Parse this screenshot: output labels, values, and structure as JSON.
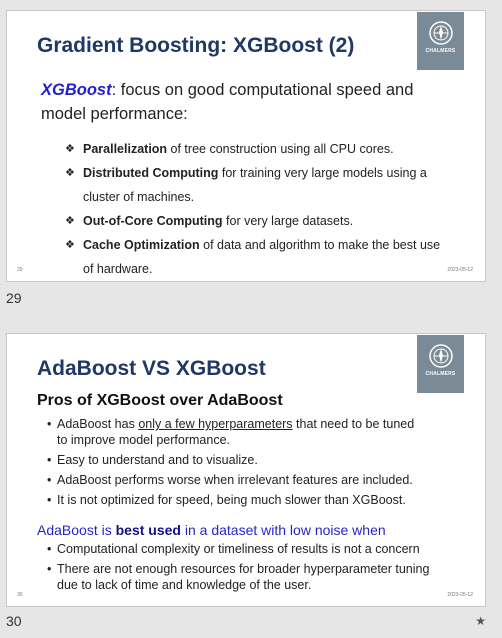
{
  "slide1": {
    "title": "Gradient Boosting: XGBoost (2)",
    "logo_text": "CHALMERS",
    "intro_keyword": "XGBoost",
    "intro_rest": ": focus on good computational speed and model performance:",
    "bullets": [
      {
        "bold": "Parallelization",
        "text": " of tree construction using all CPU cores."
      },
      {
        "bold": "Distributed Computing",
        "text": " for training very large models using a cluster of machines."
      },
      {
        "bold": "Out-of-Core Computing",
        "text": " for very large datasets."
      },
      {
        "bold": "Cache Optimization",
        "text": " of data and algorithm to make the best use of hardware."
      }
    ],
    "page": "29",
    "date": "2023-05-12",
    "label": "29"
  },
  "slide2": {
    "title": "AdaBoost VS XGBoost",
    "logo_text": "CHALMERS",
    "subhead": "Pros of XGBoost over AdaBoost",
    "pros": [
      {
        "pre": "AdaBoost has ",
        "underline": "only a few hyperparameters",
        "post": " that need to be tuned to improve model performance."
      },
      {
        "pre": "Easy to understand and to visualize.",
        "underline": "",
        "post": ""
      },
      {
        "pre": "AdaBoost performs worse when irrelevant features are included.",
        "underline": "",
        "post": ""
      },
      {
        "pre": "It is not optimized for speed, being much slower than XGBoost.",
        "underline": "",
        "post": ""
      }
    ],
    "note_pre": "AdaBoost is ",
    "note_bold": "best used",
    "note_post": " in a dataset with low noise when",
    "cases": [
      "Computational complexity or timeliness of results is not a concern",
      "There are not enough resources for broader hyperparameter tuning due to lack of time and knowledge of the user."
    ],
    "page": "30",
    "date": "2023-05-12",
    "label": "30"
  },
  "icons": {
    "diamond_bullet": "❖",
    "dot_bullet": "•",
    "star": "★"
  }
}
